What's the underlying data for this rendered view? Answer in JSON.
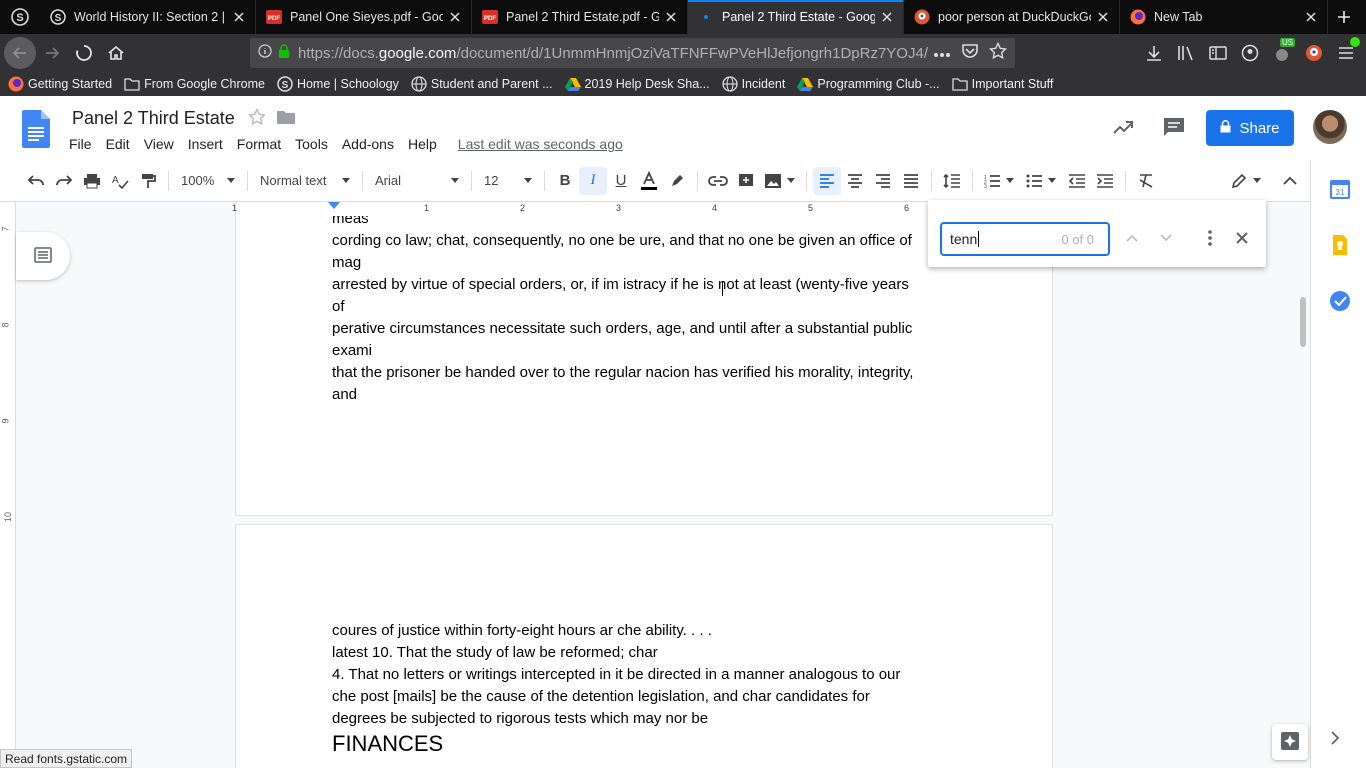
{
  "browser": {
    "tabs": [
      {
        "title": "World History II: Section 2 | S",
        "favicon": "schoology-icon",
        "active": false
      },
      {
        "title": "Panel One Sieyes.pdf - Googl",
        "favicon": "pdf-icon",
        "active": false
      },
      {
        "title": "Panel 2 Third Estate.pdf - Go",
        "favicon": "pdf-icon",
        "active": false
      },
      {
        "title": "Panel 2 Third Estate - Google",
        "favicon": "loading-dot-icon",
        "active": true
      },
      {
        "title": "poor person at DuckDuckGo",
        "favicon": "duckduckgo-icon",
        "active": false
      },
      {
        "title": "New Tab",
        "favicon": "firefox-icon",
        "active": false
      }
    ],
    "url": {
      "prefix": "https://docs.",
      "host": "google.com",
      "path": "/document/d/1UnmmHnmjOziVaTFNFFwPVeHlJefjongrh1DpRz7YOJ4/"
    },
    "bookmarks": [
      {
        "label": "Getting Started",
        "icon": "firefox-icon"
      },
      {
        "label": "From Google Chrome",
        "icon": "folder-icon"
      },
      {
        "label": "Home | Schoology",
        "icon": "schoology-icon"
      },
      {
        "label": "Student and Parent ...",
        "icon": "globe-icon"
      },
      {
        "label": "2019 Help Desk Sha...",
        "icon": "drive-icon"
      },
      {
        "label": "Incident",
        "icon": "globe-icon"
      },
      {
        "label": "Programming Club -...",
        "icon": "drive-icon"
      },
      {
        "label": "Important Stuff",
        "icon": "folder-icon"
      }
    ],
    "extension_badge": "US",
    "status_text": "Read fonts.gstatic.com"
  },
  "docs": {
    "title": "Panel 2 Third Estate",
    "menu": [
      "File",
      "Edit",
      "View",
      "Insert",
      "Format",
      "Tools",
      "Add-ons",
      "Help"
    ],
    "last_edit": "Last edit was seconds ago",
    "share_label": "Share",
    "toolbar": {
      "zoom": "100%",
      "style": "Normal text",
      "font": "Arial",
      "size": "12"
    },
    "ruler_h": [
      "1",
      "1",
      "2",
      "3",
      "4",
      "5",
      "6"
    ],
    "ruler_v": [
      "7",
      "8",
      "9",
      "10"
    ],
    "page1_lines": [
      "meas",
      "cording co law; chat, consequently, no one be ure, and that no one be given an office of",
      "mag",
      "arrested by virtue of special orders, or, if im istracy if he is not at least (wenty-five years",
      "of",
      "perative circumstances necessitate such orders, age, and until after a substantial public",
      "exami",
      "that the prisoner be handed over to the regular nacion has verified his morality, integrity,",
      "and"
    ],
    "page2_lines": [
      "coures of justice within forty-eight hours ar che ability. . . .",
      "latest 10. That the study of law be reformed; char",
      "4. That no letters or writings intercepted in it be directed in a manner analogous to our",
      "che post [mails] be the cause of the detention legislation, and char candidates for",
      "degrees be subjected to rigorous tests which may nor be"
    ],
    "page2_heading": "FINANCES",
    "find": {
      "query": "tenn",
      "count": "0 of 0"
    }
  },
  "colors": {
    "accent": "#1a73e8",
    "firefox_active_tab": "#0a84ff"
  }
}
